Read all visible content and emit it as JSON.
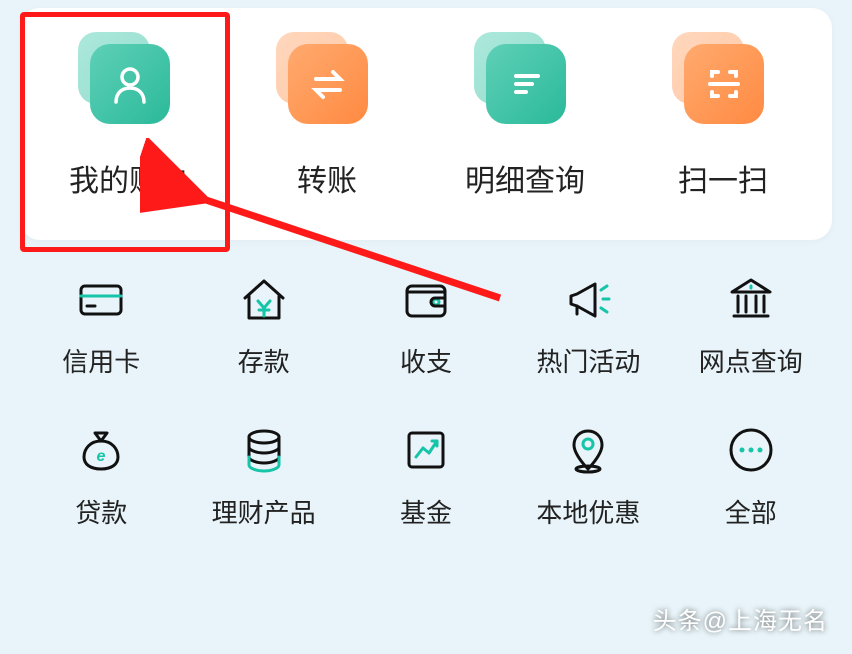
{
  "mainMenu": [
    {
      "label": "我的账户",
      "color": "teal"
    },
    {
      "label": "转账",
      "color": "orange"
    },
    {
      "label": "明细查询",
      "color": "teal"
    },
    {
      "label": "扫一扫",
      "color": "orange"
    }
  ],
  "gridMenu": [
    {
      "label": "信用卡"
    },
    {
      "label": "存款"
    },
    {
      "label": "收支"
    },
    {
      "label": "热门活动"
    },
    {
      "label": "网点查询"
    },
    {
      "label": "贷款"
    },
    {
      "label": "理财产品"
    },
    {
      "label": "基金"
    },
    {
      "label": "本地优惠"
    },
    {
      "label": "全部"
    }
  ],
  "watermark": "头条@上海无名"
}
